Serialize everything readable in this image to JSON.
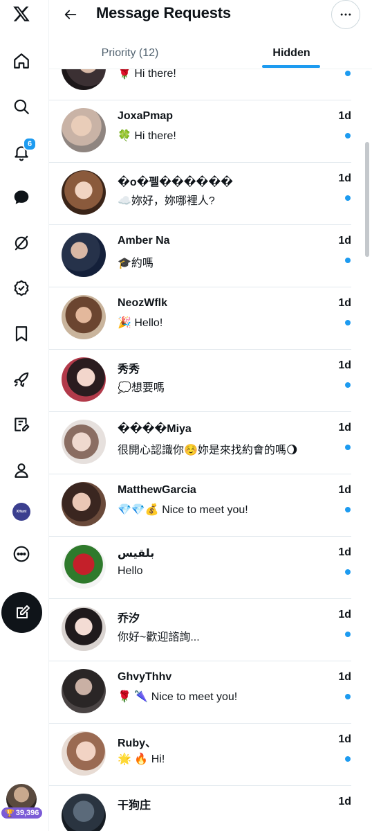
{
  "header": {
    "title": "Message Requests"
  },
  "tabs": [
    {
      "label": "Priority (12)"
    },
    {
      "label": "Hidden"
    }
  ],
  "nav": {
    "notifications_badge": "6",
    "xhunt_label": "XHunt",
    "points": "39,396"
  },
  "colors": {
    "accent": "#1d9bf0",
    "text": "#0f1419",
    "muted": "#536471"
  },
  "conversations": [
    {
      "name": ".",
      "message": "🌹 Hi there!",
      "time": ""
    },
    {
      "name": "JoxaPmap",
      "message": "🍀 Hi there!",
      "time": "1d"
    },
    {
      "name": "�o�펠������",
      "message": "☁️妳好，妳哪裡人?",
      "time": "1d"
    },
    {
      "name": "Amber Na",
      "message": "🎓約嗎",
      "time": "1d"
    },
    {
      "name": "NeozWflk",
      "message": "🎉 Hello!",
      "time": "1d"
    },
    {
      "name": "秀秀",
      "message": "💭想要嗎",
      "time": "1d"
    },
    {
      "name": "����Miya",
      "message": "很開心認識你☺️妳是來找約會的嗎🌖",
      "time": "1d"
    },
    {
      "name": "MatthewGarcia",
      "message": "💎💎💰 Nice to meet you!",
      "time": "1d"
    },
    {
      "name": "بلقيس",
      "message": "Hello",
      "time": "1d"
    },
    {
      "name": "乔汐",
      "message": "你好~歡迎諮詢...",
      "time": "1d"
    },
    {
      "name": "GhvyThhv",
      "message": "🌹 🌂 Nice to meet you!",
      "time": "1d"
    },
    {
      "name": "Ruby、",
      "message": "🌟 🔥 Hi!",
      "time": "1d"
    },
    {
      "name": "干狗庄",
      "message": "",
      "time": "1d"
    }
  ]
}
